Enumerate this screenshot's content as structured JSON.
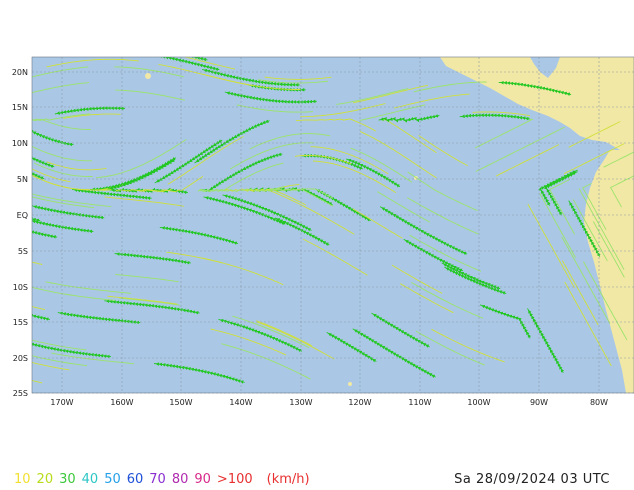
{
  "map": {
    "lat_labels": [
      "20N",
      "15N",
      "10N",
      "5N",
      "EQ",
      "5S",
      "10S",
      "15S",
      "20S",
      "25S"
    ],
    "lon_labels": [
      "170W",
      "160W",
      "150W",
      "140W",
      "130W",
      "120W",
      "110W",
      "100W",
      "90W",
      "80W"
    ],
    "colors": {
      "ocean": "#aac8e6",
      "land": "#f2e8a6",
      "grid": "#8d9aa8",
      "streamline_green": "#22c722",
      "streamline_yellow": "#cfe03a",
      "streamline_light": "#9be36b"
    }
  },
  "legend": {
    "items": [
      {
        "label": "10",
        "color": "#f2e030"
      },
      {
        "label": "20",
        "color": "#b7dc1c"
      },
      {
        "label": "30",
        "color": "#3cc83c"
      },
      {
        "label": "40",
        "color": "#2cc6c6"
      },
      {
        "label": "50",
        "color": "#24a0e8"
      },
      {
        "label": "60",
        "color": "#1e50d8"
      },
      {
        "label": "70",
        "color": "#8a2ed0"
      },
      {
        "label": "80",
        "color": "#b02ab0"
      },
      {
        "label": "90",
        "color": "#d82a8a"
      },
      {
        "label": ">100",
        "color": "#e83030"
      }
    ],
    "unit": "(km/h)",
    "unit_color": "#e83030"
  },
  "timestamp": "Sa 28/09/2024 03 UTC"
}
